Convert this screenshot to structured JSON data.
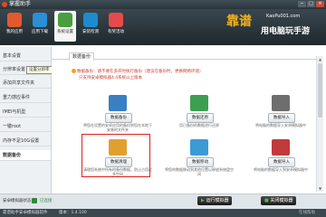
{
  "window": {
    "title": "掌握助手",
    "buttons": [
      "−",
      "□",
      "×"
    ]
  },
  "toolbar": {
    "items": [
      {
        "label": "我的应用",
        "color": "#e35a2f",
        "icon": "home-icon"
      },
      {
        "label": "应用下载",
        "color": "#2a8fd6",
        "icon": "download-icon"
      },
      {
        "label": "系统设置",
        "color": "#4a9e3f",
        "icon": "settings-icon"
      },
      {
        "label": "安装检测",
        "color": "#1e8bd0",
        "icon": "shield-icon"
      },
      {
        "label": "有奖活动",
        "color": "#e64a4a",
        "icon": "gift-icon"
      }
    ],
    "brand": {
      "main": "靠谱",
      "url": "KaoPu001.com",
      "sub": "用电脑玩手游"
    }
  },
  "sidebar": {
    "items": [
      {
        "label": "基本设置"
      },
      {
        "label": "分辨率设置"
      },
      {
        "label": "添加共享文件夹"
      },
      {
        "label": "重力感应事件"
      },
      {
        "label": "IMEI与机型"
      },
      {
        "label": "一键root"
      },
      {
        "label": "内存不足10G设置"
      },
      {
        "label": "数据备份"
      }
    ],
    "tooltip": "设置分辨率"
  },
  "main": {
    "tab": "数据备份",
    "warning": "数据备份：请不要在多开时执行备份（建议在备份时，更换网络环境）",
    "hint": "只支持安卓模拟器4.4系统以上版本",
    "cards": [
      {
        "button": "数据备份",
        "desc": "将您在设置的安卓应用的备份到您在本地下安装的文件夹",
        "color": "#3a7fc4",
        "icon": "backup-icon"
      },
      {
        "button": "数据还原",
        "desc": "用已备份的数据进行还原",
        "color": "#3d9e52",
        "icon": "restore-icon"
      },
      {
        "button": "数据导入",
        "desc": "将电脑的数据导入安卓模拟器中",
        "color": "#6e6e6e",
        "icon": "import-icon"
      },
      {
        "button": "数据清理",
        "desc": "清理您系统中所有的备份数据，防止占用过多空间",
        "color": "#e0a030",
        "icon": "clean-icon"
      },
      {
        "button": "数据移动",
        "desc": "将您的数据移动到其他位置以释放系统盘空间",
        "color": "#3a9bd6",
        "icon": "move-icon"
      },
      {
        "button": "数据导入",
        "desc": "将电脑的数据导入到安卓模拟器中",
        "color": "#c23a3a",
        "icon": "export-icon"
      }
    ]
  },
  "bottom": {
    "sdk_label": "安卓模拟器状态",
    "status": "已连接",
    "run_button": "运行模拟器",
    "close_button": "关闭模拟器"
  },
  "statusbar": {
    "left": "靠谱助手安卓模拟器软件",
    "version": "版本：1.4.100",
    "right": "在线帮助"
  }
}
